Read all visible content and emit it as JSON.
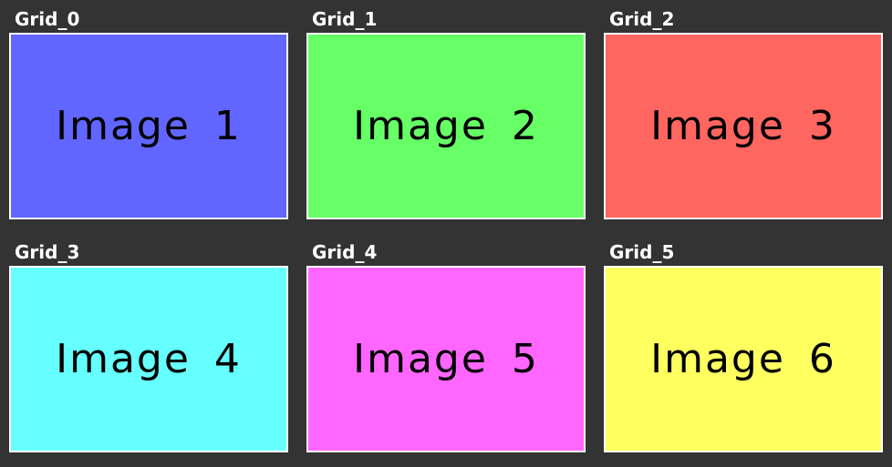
{
  "grid": {
    "cells": [
      {
        "label": "Grid_0",
        "text": "Image 1",
        "color": "#6066FF"
      },
      {
        "label": "Grid_1",
        "text": "Image 2",
        "color": "#66FF66"
      },
      {
        "label": "Grid_2",
        "text": "Image 3",
        "color": "#FF6660"
      },
      {
        "label": "Grid_3",
        "text": "Image 4",
        "color": "#66FFFF"
      },
      {
        "label": "Grid_4",
        "text": "Image 5",
        "color": "#FF66FF"
      },
      {
        "label": "Grid_5",
        "text": "Image 6",
        "color": "#FFFF60"
      }
    ]
  }
}
